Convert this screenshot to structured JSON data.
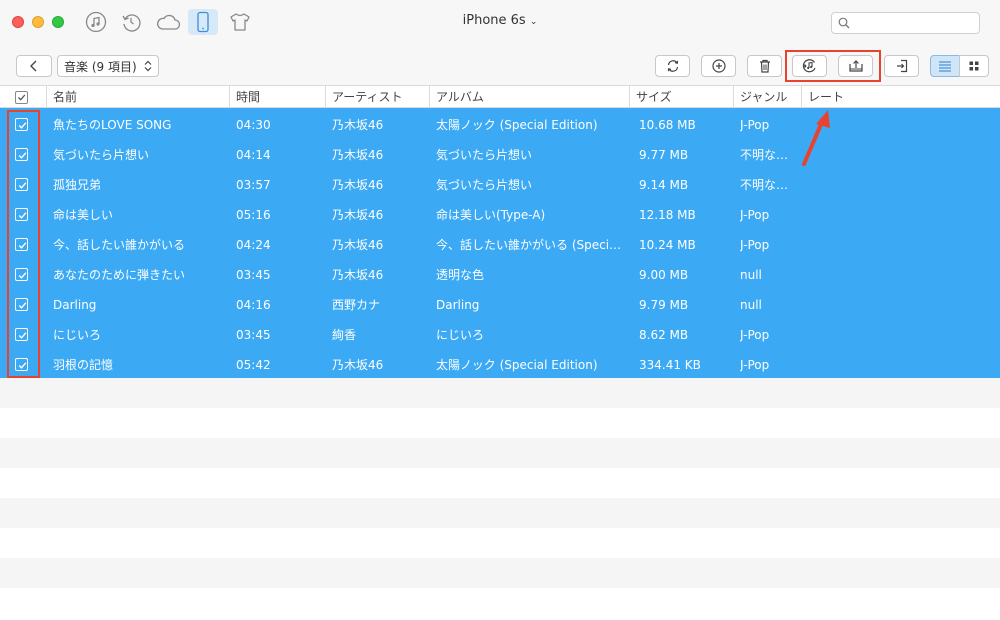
{
  "window": {
    "device_title": "iPhone 6s",
    "nav_icons": [
      "music-note-icon",
      "restore-icon",
      "cloud-icon",
      "iphone-icon",
      "tshirt-icon"
    ],
    "active_nav": "iphone-icon"
  },
  "search": {
    "placeholder": "",
    "value": ""
  },
  "toolbar": {
    "category": "音楽 (9 項目)",
    "buttons": [
      "refresh-icon",
      "add-icon",
      "trash-icon",
      "to-itunes-icon",
      "export-to-computer-icon",
      "send-to-device-icon",
      "list-view-icon",
      "grid-view-icon"
    ]
  },
  "table": {
    "columns": [
      "名前",
      "時間",
      "アーティスト",
      "アルバム",
      "サイズ",
      "ジャンル",
      "レート"
    ],
    "rows": [
      {
        "name": "魚たちのLOVE SONG",
        "time": "04:30",
        "artist": "乃木坂46",
        "album": "太陽ノック (Special Edition)",
        "size": "10.68 MB",
        "genre": "J-Pop"
      },
      {
        "name": "気づいたら片想い",
        "time": "04:14",
        "artist": "乃木坂46",
        "album": "気づいたら片想い",
        "size": "9.77 MB",
        "genre": "不明なジ…"
      },
      {
        "name": "孤独兄弟",
        "time": "03:57",
        "artist": "乃木坂46",
        "album": "気づいたら片想い",
        "size": "9.14 MB",
        "genre": "不明なジ…"
      },
      {
        "name": "命は美しい",
        "time": "05:16",
        "artist": "乃木坂46",
        "album": "命は美しい(Type-A)",
        "size": "12.18 MB",
        "genre": "J-Pop"
      },
      {
        "name": "今、話したい誰かがいる",
        "time": "04:24",
        "artist": "乃木坂46",
        "album": "今、話したい誰かがいる (Special…",
        "size": "10.24 MB",
        "genre": "J-Pop"
      },
      {
        "name": "あなたのために弾きたい",
        "time": "03:45",
        "artist": "乃木坂46",
        "album": "透明な色",
        "size": "9.00 MB",
        "genre": "null"
      },
      {
        "name": "Darling",
        "time": "04:16",
        "artist": "西野カナ",
        "album": "Darling",
        "size": "9.79 MB",
        "genre": "null"
      },
      {
        "name": "にじいろ",
        "time": "03:45",
        "artist": "絢香",
        "album": "にじいろ",
        "size": "8.62 MB",
        "genre": "J-Pop"
      },
      {
        "name": "羽根の記憶",
        "time": "05:42",
        "artist": "乃木坂46",
        "album": "太陽ノック (Special Edition)",
        "size": "334.41 KB",
        "genre": "J-Pop"
      }
    ]
  },
  "colors": {
    "selection": "#3ba9f4",
    "annotation": "#e8432e"
  }
}
